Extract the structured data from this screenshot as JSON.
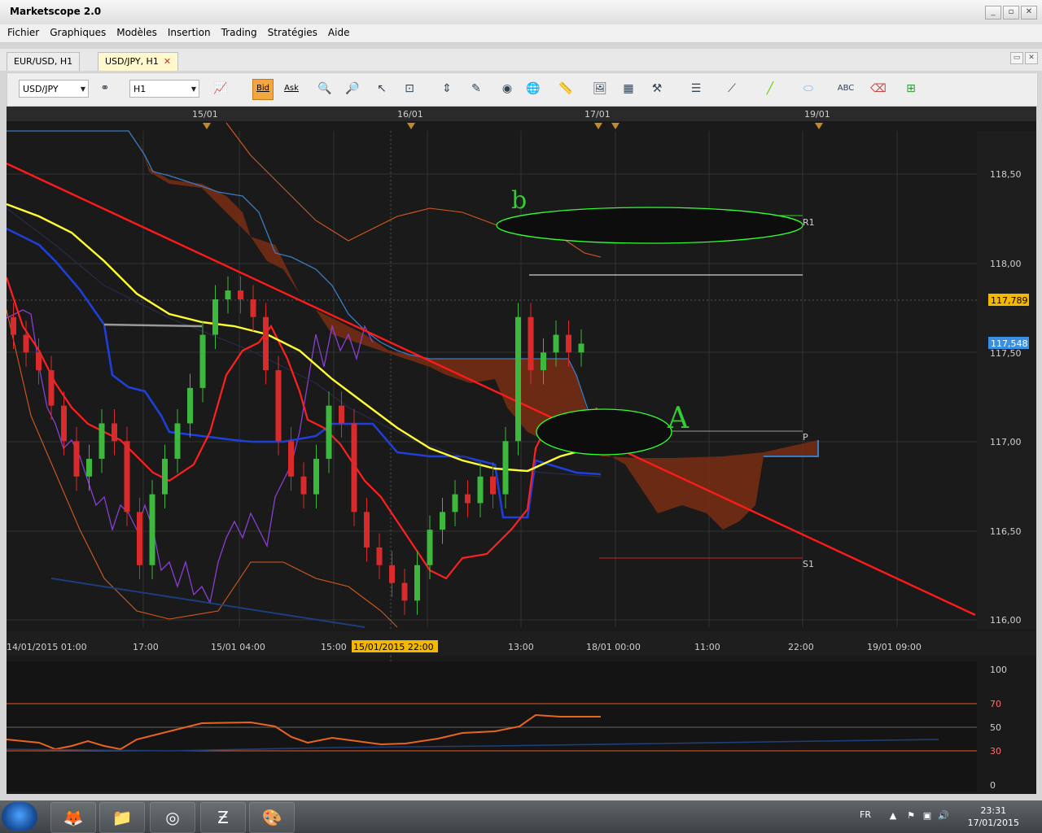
{
  "window": {
    "title": "Marketscope 2.0",
    "controls": [
      "_",
      "▫",
      "✕"
    ]
  },
  "menu": [
    "Fichier",
    "Graphiques",
    "Modèles",
    "Insertion",
    "Trading",
    "Stratégies",
    "Aide"
  ],
  "tabs": [
    {
      "label": "EUR/USD, H1",
      "active": false
    },
    {
      "label": "USD/JPY, H1",
      "active": true,
      "close": "✕"
    }
  ],
  "toolbar": {
    "instrument": "USD/JPY",
    "timeframe": "H1",
    "bid_label": "Bid",
    "ask_label": "Ask",
    "icons": [
      "indicator-icon",
      "zoom-in-icon",
      "zoom-out-icon",
      "cursor-icon",
      "zoom-range-icon",
      "scale-icon",
      "edit-chart-icon",
      "eye-icon",
      "globe-icon",
      "ruler-icon",
      "image-icon",
      "template-icon",
      "fib-icon",
      "lines-icon",
      "gann-icon",
      "trendline-icon",
      "ellipse-icon",
      "text-icon",
      "eraser-icon",
      "hierarchy-icon"
    ]
  },
  "chart": {
    "date_markers": [
      "15/01",
      "16/01",
      "17/01",
      "19/01"
    ],
    "price_labels": [
      "118,50",
      "118,00",
      "117,50",
      "117,00",
      "116,50",
      "116,00"
    ],
    "current_price_a": "117,789",
    "current_price_b": "117,548",
    "time_labels": [
      "14/01/2015 01:00",
      "17:00",
      "15/01 04:00",
      "15:00",
      "15/01/2015 22:00",
      "13:00",
      "18/01 00:00",
      "11:00",
      "22:00",
      "19/01 09:00"
    ],
    "level_labels": {
      "r1": "R1",
      "p": "P",
      "s1": "S1"
    },
    "annotations": {
      "b": "b",
      "a": "A"
    },
    "colors": {
      "background": "#1a1a1a",
      "cloud": "#7a2e14",
      "trendline": "#ff1a1a",
      "ma_yellow": "#ffff33",
      "kijun": "#1f3fd9",
      "up": "#3cb83c",
      "down": "#d92b2b",
      "ellipse": "#33ff33"
    }
  },
  "oscillator": {
    "labels": [
      "100",
      "70",
      "50",
      "30",
      "0"
    ]
  },
  "chart_data": {
    "type": "line",
    "title": "",
    "xlabel": "",
    "ylabel": "",
    "ylim": [
      115.95,
      118.75
    ],
    "levels": {
      "R1": 118.27,
      "P": 117.05,
      "S1": 116.34
    },
    "oscillator_levels": [
      70,
      50,
      30
    ],
    "candles_close": [
      117.6,
      117.5,
      117.4,
      117.2,
      117.0,
      116.8,
      116.9,
      117.1,
      117.0,
      116.6,
      116.3,
      116.7,
      116.9,
      117.1,
      117.3,
      117.6,
      117.8,
      117.85,
      117.8,
      117.7,
      117.4,
      117.0,
      116.8,
      116.7,
      116.9,
      117.2,
      117.1,
      116.6,
      116.4,
      116.3,
      116.2,
      116.1,
      116.3,
      116.5,
      116.6,
      116.7,
      116.65,
      116.8,
      116.7,
      117.0,
      117.7,
      117.4,
      117.5,
      117.6,
      117.5,
      117.55
    ]
  },
  "taskbar": {
    "apps": [
      "firefox-icon",
      "explorer-icon",
      "chrome-icon",
      "app-icon",
      "paint-icon"
    ],
    "lang": "FR",
    "time": "23:31",
    "date": "17/01/2015"
  }
}
